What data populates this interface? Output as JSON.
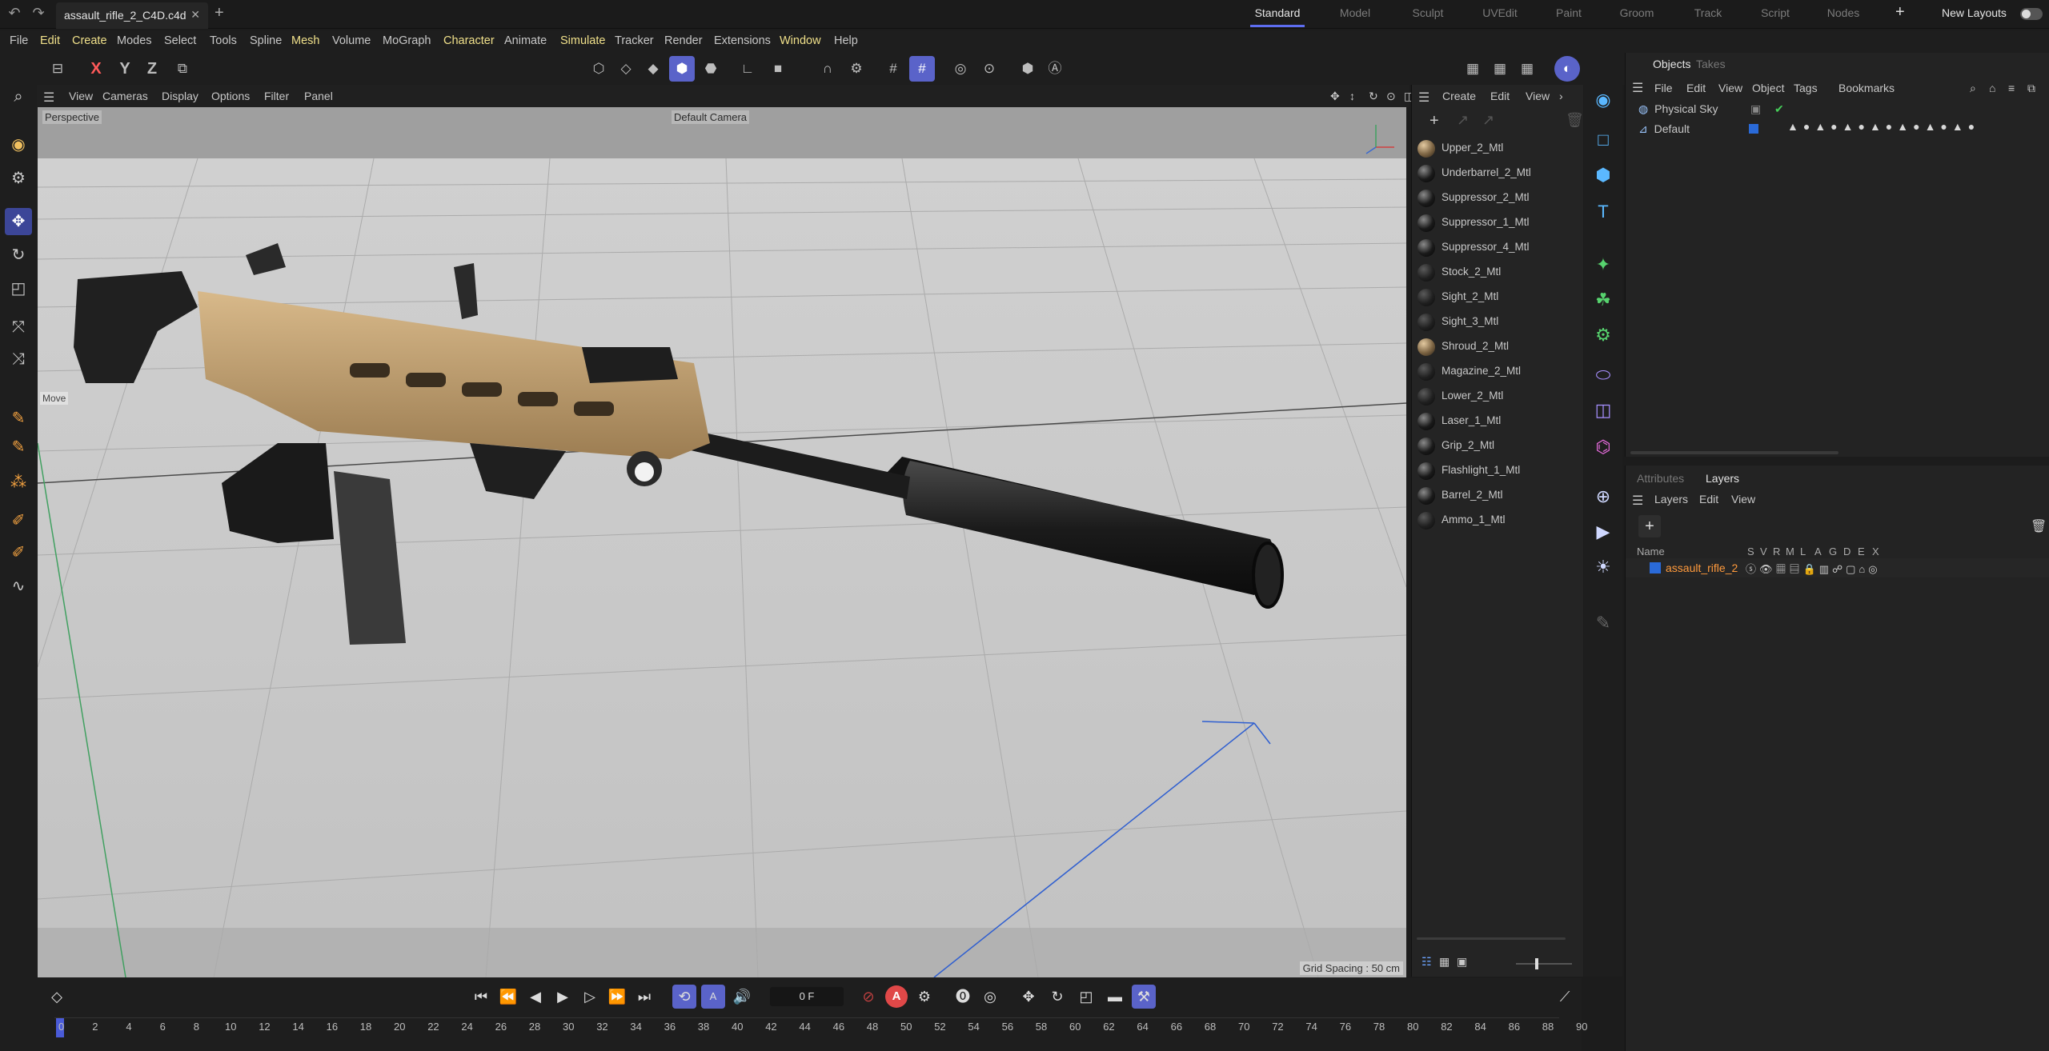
{
  "titlebar": {
    "document_tab": "assault_rifle_2_C4D.c4d",
    "layouts": [
      "Standard",
      "Model",
      "Sculpt",
      "UVEdit",
      "Paint",
      "Groom",
      "Track",
      "Script",
      "Nodes"
    ],
    "active_layout": "Standard",
    "new_layouts": "New Layouts"
  },
  "menubar": {
    "items": [
      "File",
      "Edit",
      "Create",
      "Modes",
      "Select",
      "Tools",
      "Spline",
      "Mesh",
      "Volume",
      "MoGraph",
      "Character",
      "Animate",
      "Simulate",
      "Tracker",
      "Render",
      "Extensions",
      "Window",
      "Help"
    ]
  },
  "toolbar": {
    "axis_x": "X",
    "axis_y": "Y",
    "axis_z": "Z"
  },
  "viewport": {
    "menus": [
      "View",
      "Cameras",
      "Display",
      "Options",
      "Filter",
      "Panel"
    ],
    "projection": "Perspective",
    "camera": "Default Camera",
    "grid_spacing": "Grid Spacing : 50 cm",
    "move_hint": "Move"
  },
  "materials": {
    "menus": [
      "Create",
      "Edit",
      "View"
    ],
    "items": [
      "Upper_2_Mtl",
      "Underbarrel_2_Mtl",
      "Suppressor_2_Mtl",
      "Suppressor_1_Mtl",
      "Suppressor_4_Mtl",
      "Stock_2_Mtl",
      "Sight_2_Mtl",
      "Sight_3_Mtl",
      "Shroud_2_Mtl",
      "Magazine_2_Mtl",
      "Lower_2_Mtl",
      "Laser_1_Mtl",
      "Grip_2_Mtl",
      "Flashlight_1_Mtl",
      "Barrel_2_Mtl",
      "Ammo_1_Mtl"
    ]
  },
  "objects_panel": {
    "tabs": [
      "Objects",
      "Takes"
    ],
    "menus": [
      "File",
      "Edit",
      "View",
      "Object",
      "Tags",
      "Bookmarks"
    ],
    "objects": [
      "Physical Sky",
      "Default"
    ]
  },
  "attributes_panel": {
    "tabs": [
      "Attributes",
      "Layers"
    ],
    "menus": [
      "Layers",
      "Edit",
      "View"
    ],
    "columns": [
      "Name",
      "S",
      "V",
      "R",
      "M",
      "L",
      "A",
      "G",
      "D",
      "E",
      "X"
    ],
    "layer": "assault_rifle_2",
    "layer_color": "#2a6ad8"
  },
  "timeline": {
    "current_frame": "0 F",
    "record_label": "A",
    "ticks": [
      "0",
      "2",
      "4",
      "6",
      "8",
      "10",
      "12",
      "14",
      "16",
      "18",
      "20",
      "22",
      "24",
      "26",
      "28",
      "30",
      "32",
      "34",
      "36",
      "38",
      "40",
      "42",
      "44",
      "46",
      "48",
      "50",
      "52",
      "54",
      "56",
      "58",
      "60",
      "62",
      "64",
      "66",
      "68",
      "70",
      "72",
      "74",
      "76",
      "78",
      "80",
      "82",
      "84",
      "86",
      "88",
      "90"
    ]
  },
  "colors": {
    "accent": "#5a63c9",
    "highlight_menu": "#f0e08a",
    "layer_text": "#ff9a3c"
  }
}
